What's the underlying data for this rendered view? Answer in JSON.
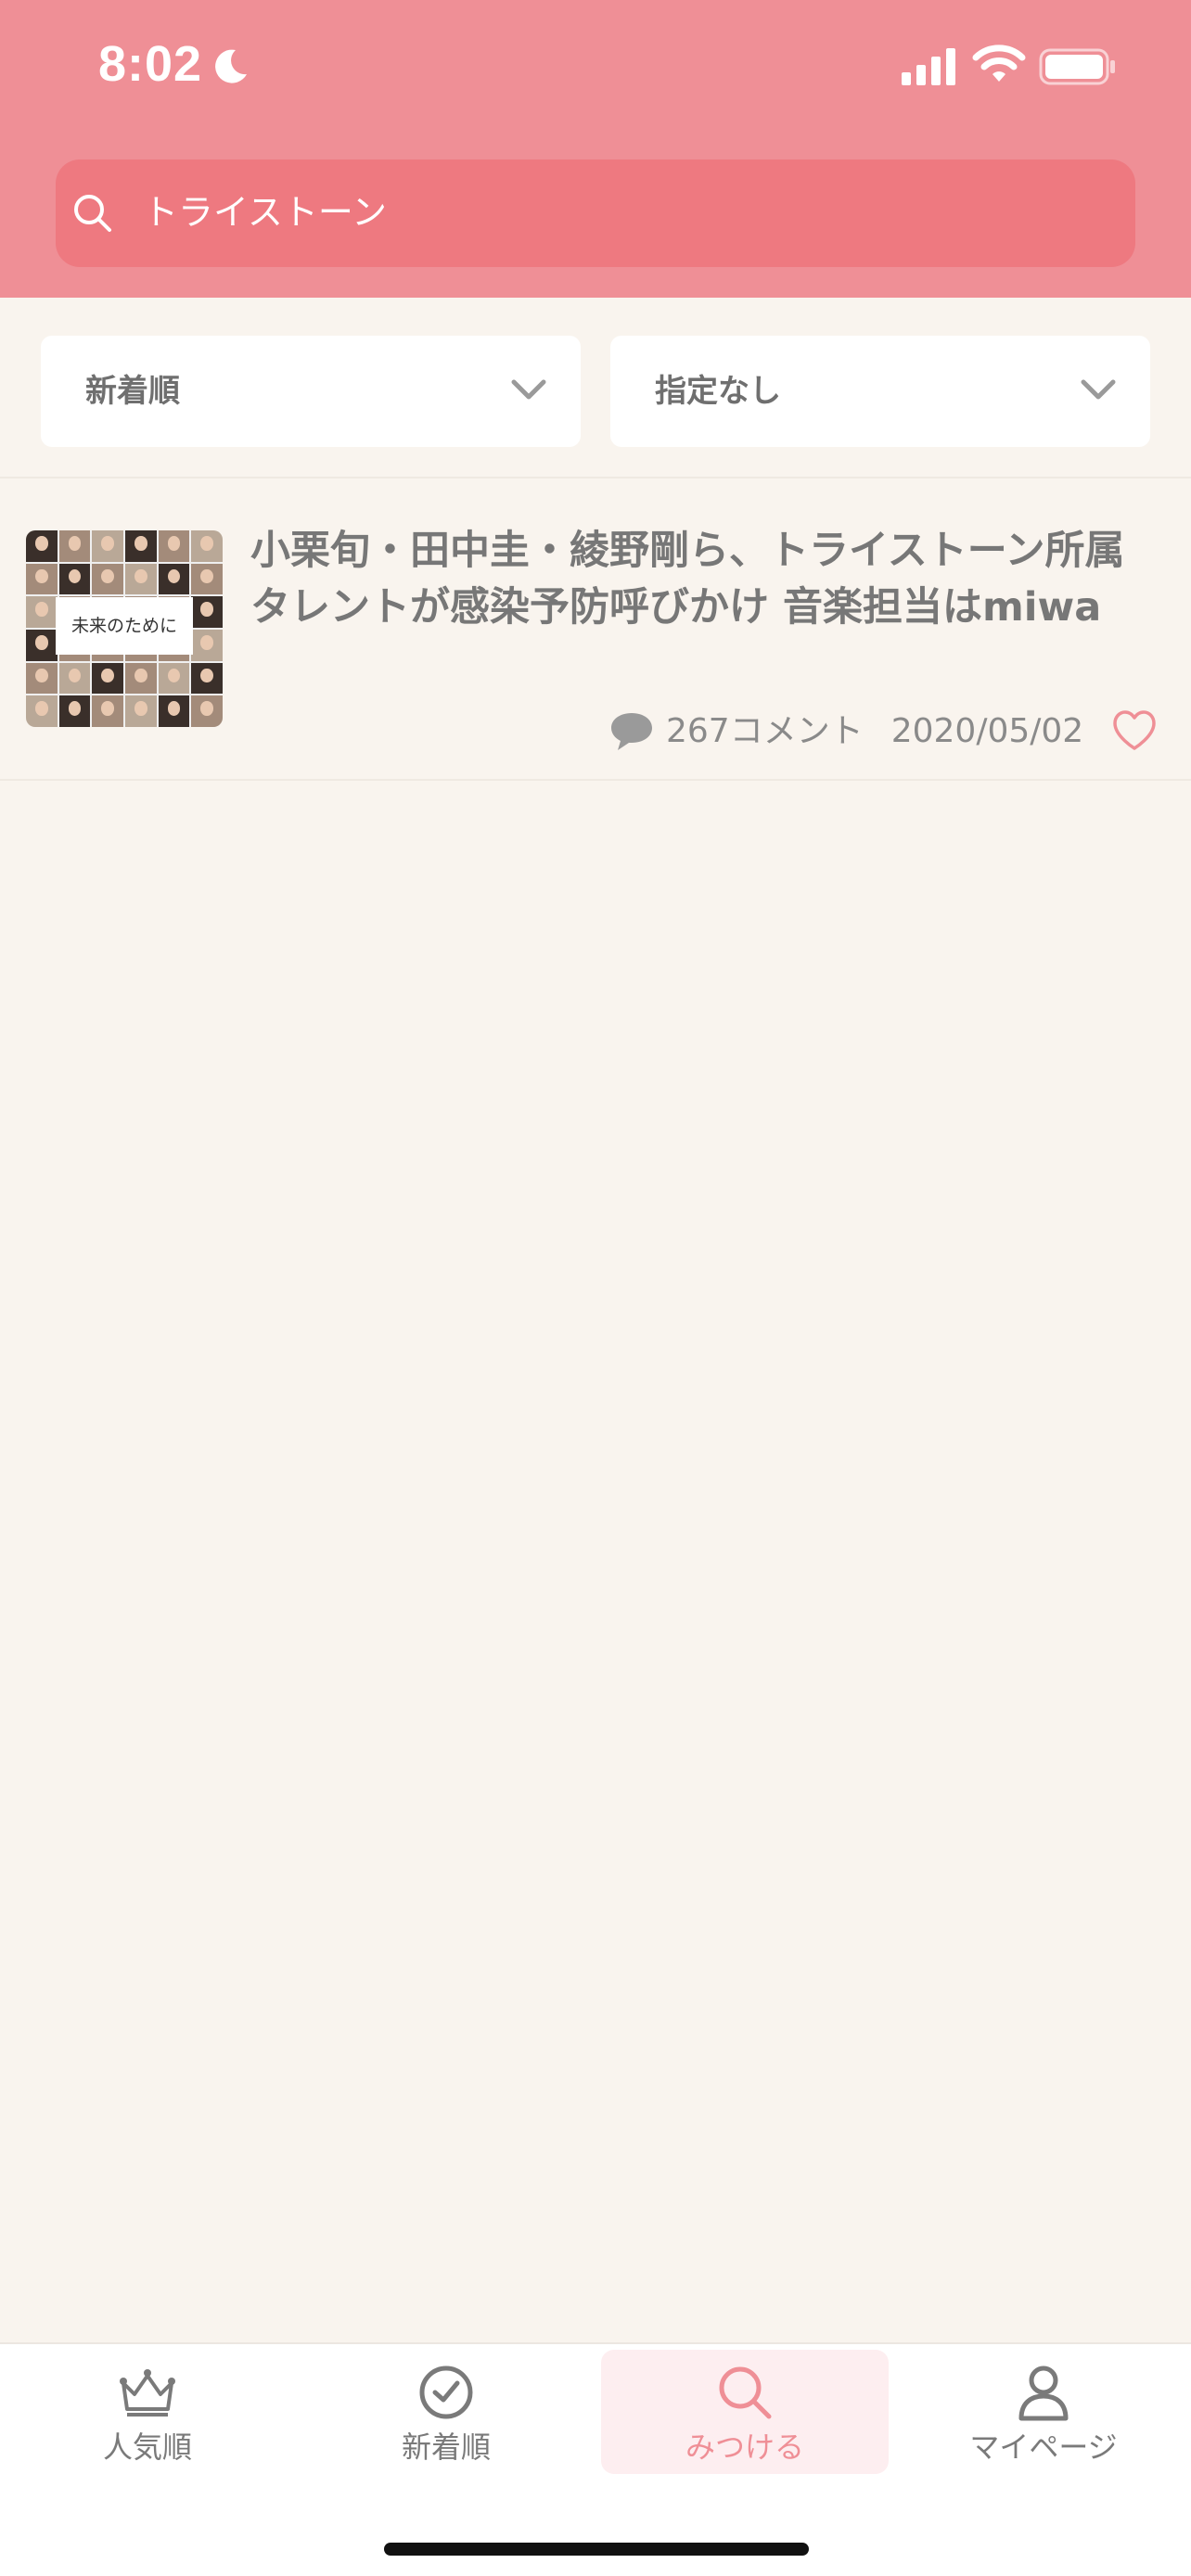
{
  "status_bar": {
    "time": "8:02"
  },
  "search": {
    "query": "トライストーン"
  },
  "filters": {
    "sort_label": "新着順",
    "filter_label": "指定なし"
  },
  "article": {
    "thumbnail_caption": "未来のために",
    "title": "小栗旬・田中圭・綾野剛ら、トライストーン所属タレントが感染予防呼びかけ 音楽担当はmiwa",
    "comment_count": "267コメント",
    "date": "2020/05/02"
  },
  "tabs": [
    {
      "label": "人気順",
      "icon": "crown-icon"
    },
    {
      "label": "新着順",
      "icon": "clock-icon"
    },
    {
      "label": "みつける",
      "icon": "search-icon",
      "active": true
    },
    {
      "label": "マイページ",
      "icon": "person-icon"
    }
  ],
  "colors": {
    "accent": "#ef8f96",
    "search_bg": "#ee7980",
    "background": "#f9f4ee"
  }
}
